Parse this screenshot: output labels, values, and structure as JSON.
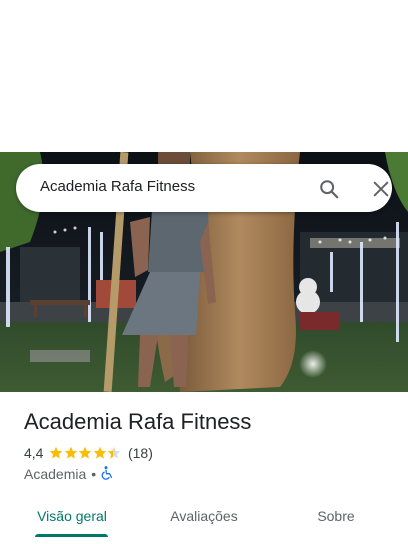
{
  "search": {
    "query": "Academia Rafa Fitness",
    "search_icon": "search-icon",
    "clear_icon": "close-icon"
  },
  "photo": {
    "description_icon": "place-photo"
  },
  "place": {
    "name": "Academia Rafa Fitness",
    "rating": "4,4",
    "rating_value": 4.4,
    "rating_max": 5,
    "review_count": "(18)",
    "category": "Academia",
    "separator": "•",
    "accessibility_icon": "wheelchair-icon"
  },
  "tabs": [
    {
      "label": "Visão geral",
      "active": true
    },
    {
      "label": "Avaliações",
      "active": false
    },
    {
      "label": "Sobre",
      "active": false
    }
  ],
  "colors": {
    "accent": "#00796b",
    "star": "#fbbc04",
    "star_empty": "#dadce0",
    "wheelchair": "#1a73e8"
  }
}
